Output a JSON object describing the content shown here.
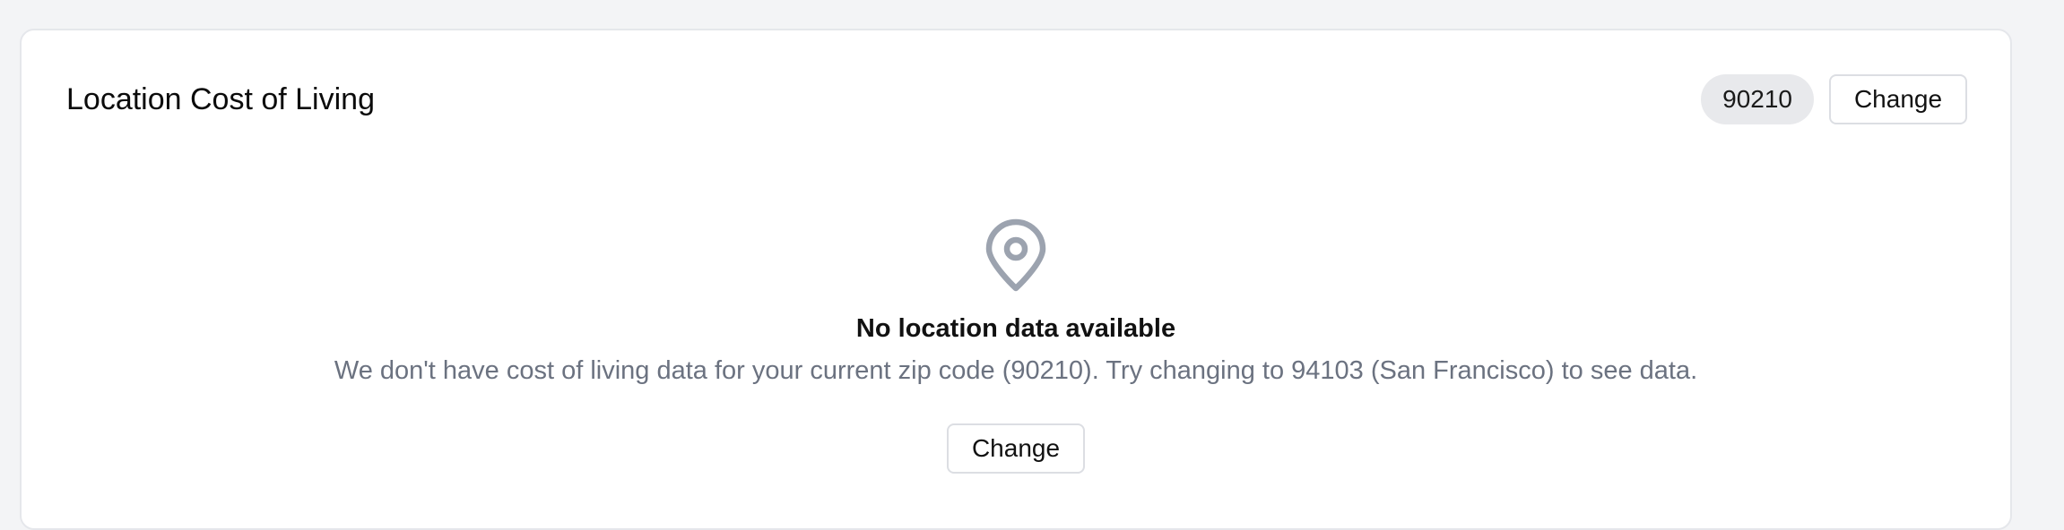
{
  "card": {
    "title": "Location Cost of Living",
    "zip_badge": "90210",
    "change_label": "Change"
  },
  "empty_state": {
    "icon": "map-pin-icon",
    "title": "No location data available",
    "description": "We don't have cost of living data for your current zip code (90210). Try changing to 94103 (San Francisco) to see data.",
    "change_label": "Change"
  },
  "colors": {
    "page_background": "#f3f4f6",
    "card_background": "#ffffff",
    "card_border": "#e5e7eb",
    "badge_background": "#e8e9ec",
    "icon": "#9ca3af",
    "muted_text": "#6b7280"
  }
}
